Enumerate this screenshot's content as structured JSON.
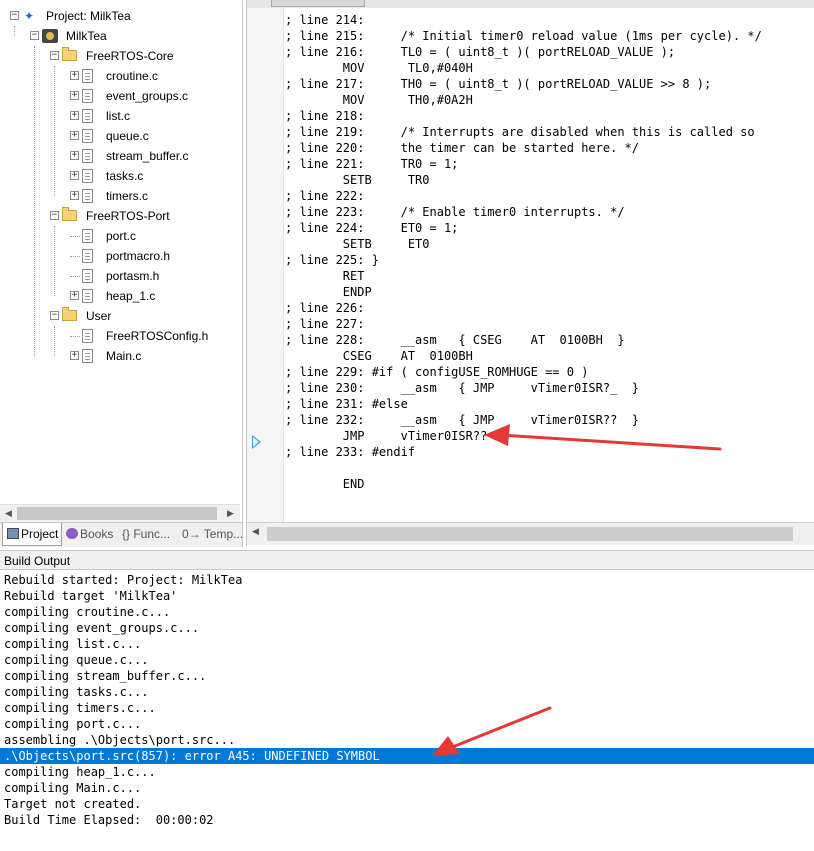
{
  "project_panel": {
    "tree": [
      {
        "label": "Project: MilkTea",
        "type": "project",
        "level": 0,
        "expander": "−"
      },
      {
        "label": "MilkTea",
        "type": "target",
        "level": 1,
        "expander": "−"
      },
      {
        "label": "FreeRTOS-Core",
        "type": "folder",
        "level": 2,
        "expander": "−"
      },
      {
        "label": "croutine.c",
        "type": "file",
        "level": 3,
        "expander": "+"
      },
      {
        "label": "event_groups.c",
        "type": "file",
        "level": 3,
        "expander": "+"
      },
      {
        "label": "list.c",
        "type": "file",
        "level": 3,
        "expander": "+"
      },
      {
        "label": "queue.c",
        "type": "file",
        "level": 3,
        "expander": "+"
      },
      {
        "label": "stream_buffer.c",
        "type": "file",
        "level": 3,
        "expander": "+"
      },
      {
        "label": "tasks.c",
        "type": "file",
        "level": 3,
        "expander": "+"
      },
      {
        "label": "timers.c",
        "type": "file",
        "level": 3,
        "expander": "+"
      },
      {
        "label": "FreeRTOS-Port",
        "type": "folder",
        "level": 2,
        "expander": "−"
      },
      {
        "label": "port.c",
        "type": "file",
        "level": 3,
        "expander": ""
      },
      {
        "label": "portmacro.h",
        "type": "file",
        "level": 3,
        "expander": ""
      },
      {
        "label": "portasm.h",
        "type": "file",
        "level": 3,
        "expander": ""
      },
      {
        "label": "heap_1.c",
        "type": "file",
        "level": 3,
        "expander": "+"
      },
      {
        "label": "User",
        "type": "folder",
        "level": 2,
        "expander": "−"
      },
      {
        "label": "FreeRTOSConfig.h",
        "type": "file",
        "level": 3,
        "expander": ""
      },
      {
        "label": "Main.c",
        "type": "file",
        "level": 3,
        "expander": "+"
      }
    ],
    "tabs": [
      {
        "label": "Project",
        "active": true
      },
      {
        "label": "Books",
        "active": false
      },
      {
        "label": "{} Func...",
        "active": false
      },
      {
        "label": "0→ Temp...",
        "active": false
      }
    ]
  },
  "editor": {
    "lines": [
      "; line 214:",
      "; line 215:     /* Initial timer0 reload value (1ms per cycle). */",
      "; line 216:     TL0 = ( uint8_t )( portRELOAD_VALUE );",
      "        MOV      TL0,#040H",
      "; line 217:     TH0 = ( uint8_t )( portRELOAD_VALUE >> 8 );",
      "        MOV      TH0,#0A2H",
      "; line 218:",
      "; line 219:     /* Interrupts are disabled when this is called so",
      "; line 220:     the timer can be started here. */",
      "; line 221:     TR0 = 1;",
      "        SETB     TR0",
      "; line 222:",
      "; line 223:     /* Enable timer0 interrupts. */",
      "; line 224:     ET0 = 1;",
      "        SETB     ET0",
      "; line 225: }",
      "        RET",
      "        ENDP",
      "; line 226:",
      "; line 227:",
      "; line 228:     __asm   { CSEG    AT  0100BH  }",
      "        CSEG    AT  0100BH",
      "; line 229: #if ( configUSE_ROMHUGE == 0 )",
      "; line 230:     __asm   { JMP     vTimer0ISR?_  }",
      "; line 231: #else",
      "; line 232:     __asm   { JMP     vTimer0ISR??  }",
      "        JMP     vTimer0ISR??",
      "; line 233: #endif",
      "",
      "        END"
    ]
  },
  "build_output": {
    "title": "Build Output",
    "lines": [
      "Rebuild started: Project: MilkTea",
      "Rebuild target 'MilkTea'",
      "compiling croutine.c...",
      "compiling event_groups.c...",
      "compiling list.c...",
      "compiling queue.c...",
      "compiling stream_buffer.c...",
      "compiling tasks.c...",
      "compiling timers.c...",
      "compiling port.c...",
      "assembling .\\Objects\\port.src...",
      ".\\Objects\\port.src(857): error A45: UNDEFINED SYMBOL",
      "compiling heap_1.c...",
      "compiling Main.c...",
      "Target not created.",
      "Build Time Elapsed:  00:00:02"
    ],
    "highlighted_index": 11
  },
  "colors": {
    "selection": "#0078d7",
    "annotation_arrow": "#e53935",
    "folder": "#f3d27a"
  }
}
